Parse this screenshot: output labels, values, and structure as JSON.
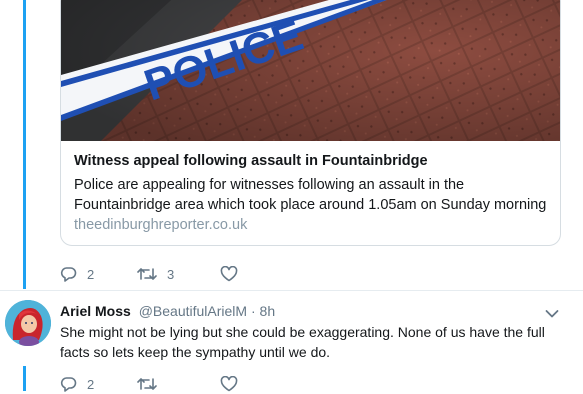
{
  "tweet1": {
    "card": {
      "tape_text": "POLICE",
      "title": "Witness appeal following assault in Fountainbridge",
      "description": "Police are appealing for witnesses following an assault in the Fountainbridge area which took place around 1.05am on Sunday morning",
      "domain": "theedinburghreporter.co.uk"
    },
    "actions": {
      "reply_count": "2",
      "retweet_count": "3",
      "like_count": ""
    }
  },
  "tweet2": {
    "author_name": "Ariel Moss",
    "handle": "@BeautifulArielM",
    "separator": "·",
    "time": "8h",
    "text": "She might not be lying but she could be exaggerating. None of us have the full facts so lets keep the sympathy until we do.",
    "actions": {
      "reply_count": "2",
      "retweet_count": "",
      "like_count": ""
    }
  },
  "colors": {
    "thread_line": "#1da1f2",
    "action_gray": "#657786",
    "domain_gray": "#8899a6",
    "tape_blue": "#1f4fb3"
  }
}
